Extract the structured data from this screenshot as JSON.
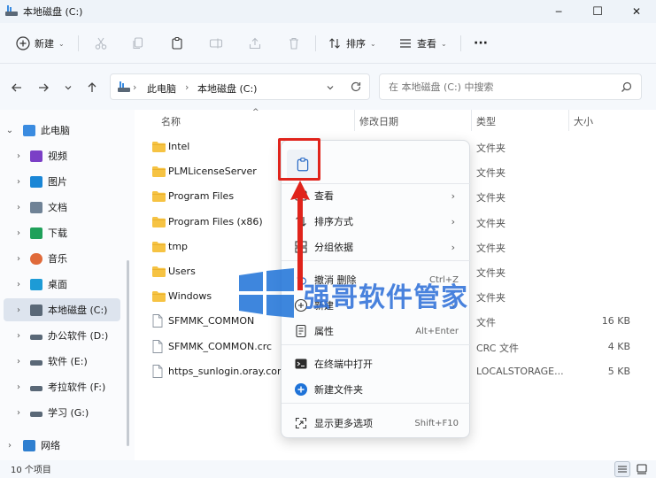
{
  "window": {
    "title": "本地磁盘 (C:)",
    "minimize_glyph": "─",
    "maximize_glyph": "☐",
    "close_glyph": "✕"
  },
  "toolbar": {
    "new_label": "新建",
    "sort_label": "排序",
    "view_label": "查看",
    "more_label": "···"
  },
  "address": {
    "crumbs": [
      "此电脑",
      "本地磁盘 (C:)"
    ],
    "separator": "›",
    "search_placeholder": "在 本地磁盘 (C:) 中搜索"
  },
  "sidebar": {
    "items": [
      {
        "label": "此电脑",
        "icon": "pc-icon"
      },
      {
        "label": "视频",
        "icon": "video-icon"
      },
      {
        "label": "图片",
        "icon": "picture-icon"
      },
      {
        "label": "文档",
        "icon": "document-icon"
      },
      {
        "label": "下载",
        "icon": "download-icon"
      },
      {
        "label": "音乐",
        "icon": "music-icon"
      },
      {
        "label": "桌面",
        "icon": "desktop-icon"
      },
      {
        "label": "本地磁盘 (C:)",
        "icon": "drive-icon"
      },
      {
        "label": "办公软件 (D:)",
        "icon": "drive-icon"
      },
      {
        "label": "软件 (E:)",
        "icon": "drive-icon"
      },
      {
        "label": "考拉软件 (F:)",
        "icon": "drive-icon"
      },
      {
        "label": "学习 (G:)",
        "icon": "drive-icon"
      },
      {
        "label": "网络",
        "icon": "network-icon"
      }
    ]
  },
  "columns": {
    "name": "名称",
    "modified": "修改日期",
    "type": "类型",
    "size": "大小"
  },
  "files": [
    {
      "name": "Intel",
      "type": "文件夹",
      "size": "",
      "kind": "folder"
    },
    {
      "name": "PLMLicenseServer",
      "type": "文件夹",
      "size": "",
      "kind": "folder"
    },
    {
      "name": "Program Files",
      "type": "文件夹",
      "size": "",
      "kind": "folder"
    },
    {
      "name": "Program Files (x86)",
      "type": "文件夹",
      "size": "",
      "kind": "folder"
    },
    {
      "name": "tmp",
      "type": "文件夹",
      "size": "",
      "kind": "folder"
    },
    {
      "name": "Users",
      "type": "文件夹",
      "size": "",
      "kind": "folder"
    },
    {
      "name": "Windows",
      "type": "文件夹",
      "size": "",
      "kind": "folder"
    },
    {
      "name": "SFMMK_COMMON",
      "type": "文件",
      "size": "16 KB",
      "kind": "file"
    },
    {
      "name": "SFMMK_COMMON.crc",
      "type": "CRC 文件",
      "size": "4 KB",
      "kind": "file"
    },
    {
      "name": "https_sunlogin.oray.com",
      "type": "LOCALSTORAGE...",
      "size": "5 KB",
      "kind": "file"
    }
  ],
  "context_menu": {
    "items": [
      {
        "label": "查看",
        "shortcut": "",
        "submenu": "›",
        "icon": "view-icon"
      },
      {
        "label": "排序方式",
        "shortcut": "",
        "submenu": "›",
        "icon": "sort-icon"
      },
      {
        "label": "分组依据",
        "shortcut": "",
        "submenu": "›",
        "icon": "group-icon"
      },
      {
        "label": "撤消 删除",
        "shortcut": "Ctrl+Z",
        "submenu": "",
        "icon": "undo-icon"
      },
      {
        "label": "新建",
        "shortcut": "",
        "submenu": "›",
        "icon": "new-icon"
      },
      {
        "label": "属性",
        "shortcut": "Alt+Enter",
        "submenu": "",
        "icon": "properties-icon"
      },
      {
        "label": "在终端中打开",
        "shortcut": "",
        "submenu": "",
        "icon": "terminal-icon"
      },
      {
        "label": "新建文件夹",
        "shortcut": "",
        "submenu": "",
        "icon": "new-folder-icon"
      },
      {
        "label": "显示更多选项",
        "shortcut": "Shift+F10",
        "submenu": "",
        "icon": "more-options-icon"
      }
    ]
  },
  "status": {
    "item_count": "10 个项目"
  },
  "watermark": {
    "text": "强哥软件管家"
  },
  "colors": {
    "accent": "#0067c0",
    "folder": "#f6c343",
    "highlight": "#e0231b",
    "watermark": "#2d6fd8"
  }
}
